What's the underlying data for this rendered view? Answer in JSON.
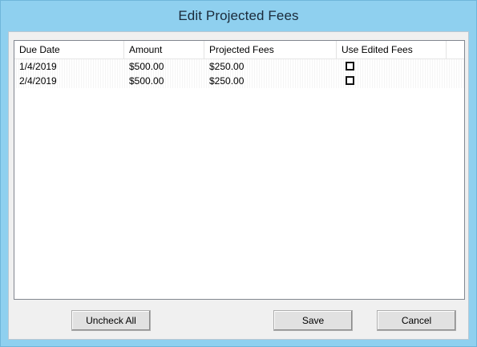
{
  "window": {
    "title": "Edit Projected Fees"
  },
  "table": {
    "columns": [
      "Due Date",
      "Amount",
      "Projected Fees",
      "Use Edited Fees"
    ],
    "rows": [
      {
        "due_date": "1/4/2019",
        "amount": "$500.00",
        "projected_fees": "$250.00",
        "use_edited_fees": false
      },
      {
        "due_date": "2/4/2019",
        "amount": "$500.00",
        "projected_fees": "$250.00",
        "use_edited_fees": false
      }
    ]
  },
  "buttons": {
    "uncheck_all": "Uncheck All",
    "save": "Save",
    "cancel": "Cancel"
  },
  "colors": {
    "title_bar": "#8fd0ef",
    "client_background": "#f0f0f0",
    "list_background": "#ffffff"
  }
}
